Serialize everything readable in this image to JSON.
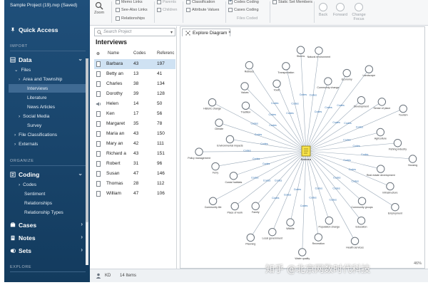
{
  "sidebar": {
    "project_title": "Sample Project (19).nvp (Saved)",
    "quick_access": "Quick Access",
    "sections": {
      "import": "IMPORT",
      "organize": "ORGANIZE",
      "explore": "EXPLORE"
    },
    "data": {
      "label": "Data",
      "files": "Files",
      "area_township": "Area and Township",
      "interviews": "Interviews",
      "literature": "Literature",
      "news_articles": "News Articles",
      "social_media": "Social Media",
      "survey": "Survey",
      "file_classifications": "File Classifications",
      "externals": "Externals"
    },
    "coding": {
      "label": "Coding",
      "codes": "Codes",
      "sentiment": "Sentiment",
      "relationships": "Relationships",
      "relationship_types": "Relationship Types"
    },
    "cases": "Cases",
    "notes": "Notes",
    "sets": "Sets"
  },
  "toolbar": {
    "zoom": "Zoom",
    "memo_links": "Memo Links",
    "see_also_links": "See-Also Links",
    "relationships": "Relationships",
    "parents": "Parents",
    "children": "Children",
    "classification": "Classification",
    "attribute_values": "Attribute Values",
    "codes_coding": "Codes Coding",
    "cases_coding": "Cases Coding",
    "files_coded": "Files Coded",
    "static_set_members": "Static Set Members",
    "back": "Back",
    "forward": "Forward",
    "change_focus_1": "Change",
    "change_focus_2": "Focus"
  },
  "list": {
    "search_placeholder": "Search Project",
    "title": "Interviews",
    "columns": [
      "Name",
      "Codes",
      "Referenc"
    ],
    "rows": [
      {
        "name": "Barbara",
        "codes": "43",
        "refs": "197",
        "icon": "document"
      },
      {
        "name": "Betty an",
        "codes": "13",
        "refs": "41",
        "icon": "document"
      },
      {
        "name": "Charles",
        "codes": "38",
        "refs": "134",
        "icon": "document"
      },
      {
        "name": "Dorothy",
        "codes": "39",
        "refs": "128",
        "icon": "document"
      },
      {
        "name": "Helen",
        "codes": "14",
        "refs": "50",
        "icon": "audio"
      },
      {
        "name": "Ken",
        "codes": "17",
        "refs": "56",
        "icon": "document"
      },
      {
        "name": "Margaret",
        "codes": "35",
        "refs": "78",
        "icon": "document"
      },
      {
        "name": "Maria an",
        "codes": "43",
        "refs": "150",
        "icon": "document"
      },
      {
        "name": "Mary an",
        "codes": "42",
        "refs": "111",
        "icon": "document"
      },
      {
        "name": "Richard a",
        "codes": "43",
        "refs": "151",
        "icon": "document"
      },
      {
        "name": "Robert",
        "codes": "31",
        "refs": "96",
        "icon": "document"
      },
      {
        "name": "Susan",
        "codes": "47",
        "refs": "146",
        "icon": "document"
      },
      {
        "name": "Thomas",
        "codes": "28",
        "refs": "112",
        "icon": "document"
      },
      {
        "name": "William",
        "codes": "47",
        "refs": "106",
        "icon": "document"
      }
    ]
  },
  "diagram": {
    "tab_label": "Explore Diagram",
    "tab_close": "×",
    "edge_label": "Codes",
    "zoom_level": "46%",
    "center_label": "Barbara",
    "nodes": [
      "Natural environment",
      "Community change",
      "Economy",
      "Landscape",
      "Development",
      "Sense of place",
      "Tourism",
      "Agriculture",
      "Fishing industry",
      "Housing",
      "Real estate development",
      "Infrastructure",
      "Employment",
      "Community groups",
      "Education",
      "Health services",
      "Population change",
      "Recreation",
      "Water quality",
      "Wildlife",
      "Local government",
      "Planning",
      "Family",
      "Place of work",
      "Community life",
      "Costal habitats",
      "Ferry",
      "Policy management",
      "Environmental impacts",
      "Climate",
      "Historic change",
      "Tradition",
      "Values",
      "Retirees",
      "Youth",
      "Transportation",
      "Storms"
    ]
  },
  "status": {
    "user": "KD",
    "items": "14 Items"
  },
  "watermark": "知乎 @北京网数时代科技"
}
